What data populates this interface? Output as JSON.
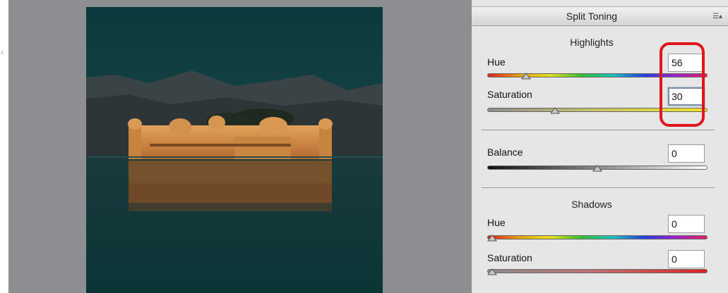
{
  "panel": {
    "title": "Split Toning",
    "menu_icon": "panel-menu-icon"
  },
  "highlights": {
    "heading": "Highlights",
    "hue": {
      "label": "Hue",
      "value": "56",
      "level": 0.16
    },
    "saturation": {
      "label": "Saturation",
      "value": "30",
      "level": 0.3
    }
  },
  "balance": {
    "label": "Balance",
    "value": "0",
    "level": 0.5
  },
  "shadows": {
    "heading": "Shadows",
    "hue": {
      "label": "Hue",
      "value": "0",
      "level": 0.0
    },
    "saturation": {
      "label": "Saturation",
      "value": "0",
      "level": 0.0
    }
  },
  "colors": {
    "annotation_ring": "#e0161d",
    "panel_bg": "#e6e6e6",
    "canvas_bg": "#8d8e92"
  }
}
